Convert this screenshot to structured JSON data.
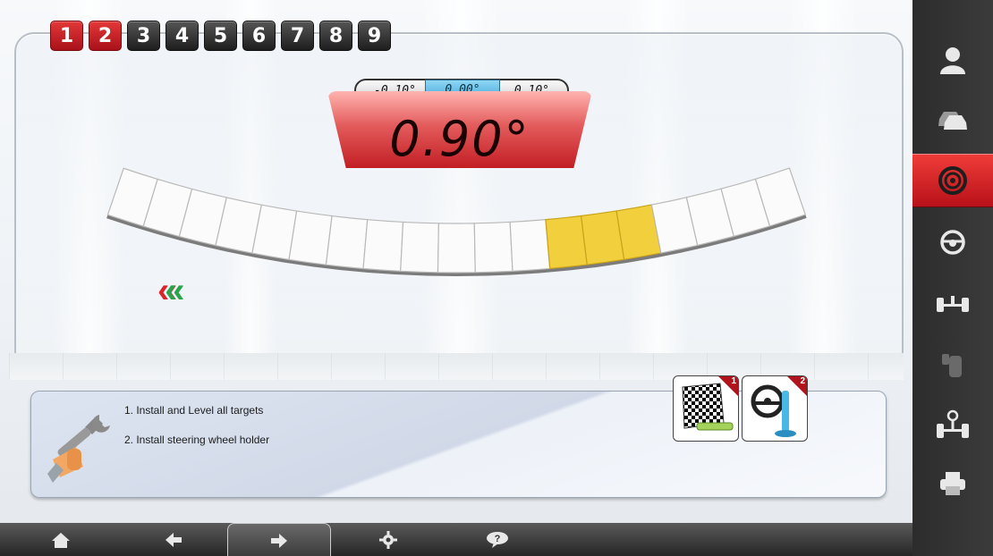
{
  "steps": [
    {
      "label": "1",
      "state": "done"
    },
    {
      "label": "2",
      "state": "done"
    },
    {
      "label": "3",
      "state": "todo"
    },
    {
      "label": "4",
      "state": "todo"
    },
    {
      "label": "5",
      "state": "todo"
    },
    {
      "label": "6",
      "state": "todo"
    },
    {
      "label": "7",
      "state": "todo"
    },
    {
      "label": "8",
      "state": "todo"
    },
    {
      "label": "9",
      "state": "todo"
    }
  ],
  "gauge": {
    "tolerance_min": "-0.10°",
    "tolerance_center": "0.00°",
    "tolerance_max": "0.10°",
    "value": "0.90°",
    "highlighted_segments": [
      12,
      13,
      14
    ],
    "colors": {
      "highlight": "#f2cf3c",
      "value_bg": "#d9373b",
      "center": "#4fb4e3"
    }
  },
  "direction_arrows": {
    "glyph": "«",
    "colors": [
      "#d8252b",
      "#29a64b"
    ]
  },
  "info": {
    "instructions": [
      "1. Install and Level all targets",
      "2. Install steering wheel holder"
    ],
    "thumbnails": [
      {
        "badge": "1",
        "icon": "target-level-icon"
      },
      {
        "badge": "2",
        "icon": "steering-wheel-holder-icon"
      }
    ]
  },
  "bottombar": {
    "buttons": [
      "home-icon",
      "back-arrow-icon",
      "forward-arrow-icon",
      "settings-gear-icon",
      "help-icon"
    ]
  },
  "sidebar": {
    "items": [
      "customer-icon",
      "vehicle-icon",
      "wheel-alignment-icon",
      "steering-wheel-icon",
      "axle-icon",
      "tire-icon",
      "axle-adjust-icon",
      "printer-icon"
    ],
    "active_index": 2,
    "active_color": "#d62029"
  }
}
